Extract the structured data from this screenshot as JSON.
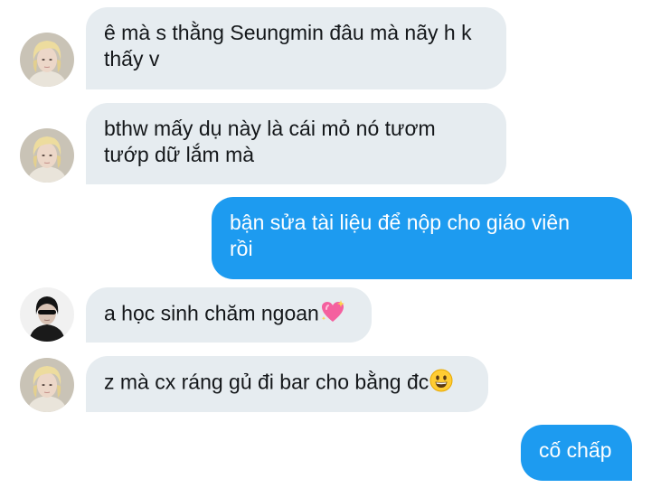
{
  "messages": [
    {
      "id": 1,
      "direction": "incoming",
      "sender_avatar": "blonde-avatar",
      "line1": "ê mà s thằng Seungmin đâu mà nãy h k",
      "line2": "thấy v"
    },
    {
      "id": 2,
      "direction": "incoming",
      "sender_avatar": "blonde-avatar",
      "line1": "bthw mấy dụ này là cái mỏ nó tươm",
      "line2": "tướp dữ lắm mà"
    },
    {
      "id": 3,
      "direction": "outgoing",
      "line1": "bận sửa tài liệu để nộp cho giáo viên",
      "line2": "rồi"
    },
    {
      "id": 4,
      "direction": "incoming",
      "sender_avatar": "dark-hair-sunglasses-avatar",
      "line1": "a học sinh chăm ngoan",
      "emoji": "sparkling-heart"
    },
    {
      "id": 5,
      "direction": "incoming",
      "sender_avatar": "blonde-avatar",
      "line1": "z mà cx ráng gủ đi bar cho bằng đc",
      "emoji": "grinning-face"
    },
    {
      "id": 6,
      "direction": "outgoing",
      "line1": "cố chấp"
    }
  ],
  "colors": {
    "incoming_bubble": "#e6ecf0",
    "outgoing_bubble": "#1d9bf0",
    "incoming_text": "#14171a",
    "outgoing_text": "#ffffff"
  }
}
